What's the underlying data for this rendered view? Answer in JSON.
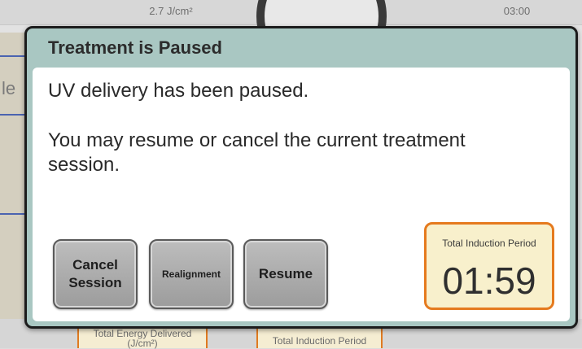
{
  "background": {
    "top_energy": "2.7 J/cm²",
    "top_time": "03:00",
    "left_partial_text": "le",
    "bottom_energy_label": "Total Energy Delivered (J/cm²)",
    "bottom_induction_label": "Total Induction Period"
  },
  "dialog": {
    "title": "Treatment is Paused",
    "message_1": "UV delivery has been paused.",
    "message_2": "You may resume or cancel the current treatment session.",
    "buttons": {
      "cancel": "Cancel Session",
      "realignment": "Realignment",
      "resume": "Resume"
    },
    "induction": {
      "label": "Total Induction Period",
      "time": "01:59"
    }
  },
  "colors": {
    "dialog_header": "#a9c7c2",
    "induction_border": "#e57a1e",
    "induction_fill": "#f8f0cc",
    "button_fill": "#b0b0b0"
  }
}
